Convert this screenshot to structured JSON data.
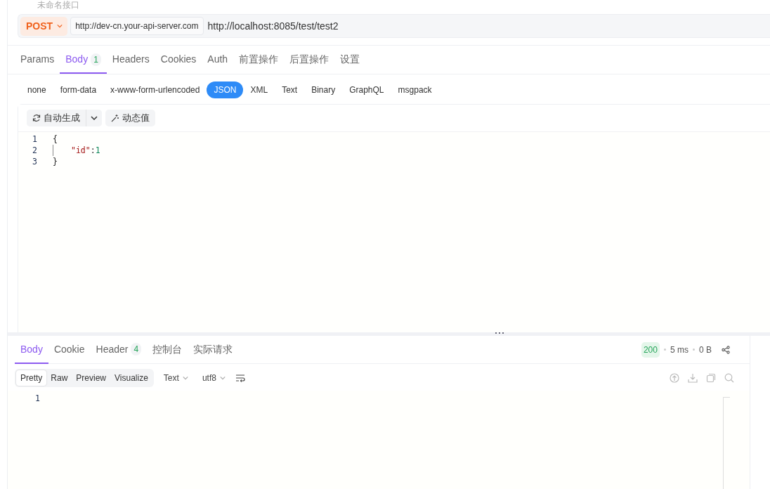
{
  "title": "未命名接口",
  "request": {
    "method": "POST",
    "base_url": "http://dev-cn.your-api-server.com",
    "path": "http://localhost:8085/test/test2"
  },
  "request_tabs": [
    {
      "label": "Params",
      "selected": false
    },
    {
      "label": "Body",
      "badge": "1",
      "selected": true
    },
    {
      "label": "Headers",
      "selected": false
    },
    {
      "label": "Cookies",
      "selected": false
    },
    {
      "label": "Auth",
      "selected": false
    },
    {
      "label": "前置操作",
      "selected": false
    },
    {
      "label": "后置操作",
      "selected": false
    },
    {
      "label": "设置",
      "selected": false
    }
  ],
  "body_types": [
    {
      "label": "none",
      "selected": false
    },
    {
      "label": "form-data",
      "selected": false
    },
    {
      "label": "x-www-form-urlencoded",
      "selected": false
    },
    {
      "label": "JSON",
      "selected": true
    },
    {
      "label": "XML",
      "selected": false
    },
    {
      "label": "Text",
      "selected": false
    },
    {
      "label": "Binary",
      "selected": false
    },
    {
      "label": "GraphQL",
      "selected": false
    },
    {
      "label": "msgpack",
      "selected": false
    }
  ],
  "editor_toolbar": {
    "generate_button": "自动生成",
    "dynamic_button": "动态值"
  },
  "editor_lines": [
    {
      "number": "1",
      "indent_guide": false,
      "tokens": [
        {
          "kind": "punct",
          "text": "{"
        }
      ]
    },
    {
      "number": "2",
      "indent_guide": true,
      "tokens": [
        {
          "kind": "key",
          "text": "\"id\""
        },
        {
          "kind": "punct",
          "text": ":"
        },
        {
          "kind": "number",
          "text": "1"
        }
      ]
    },
    {
      "number": "3",
      "indent_guide": false,
      "tokens": [
        {
          "kind": "punct",
          "text": "}"
        }
      ]
    }
  ],
  "response_tabs": [
    {
      "label": "Body",
      "selected": true
    },
    {
      "label": "Cookie",
      "selected": false
    },
    {
      "label": "Header",
      "badge": "4",
      "selected": false
    },
    {
      "label": "控制台",
      "selected": false
    },
    {
      "label": "实际请求",
      "selected": false
    }
  ],
  "response_status": {
    "code": "200",
    "time": "5 ms",
    "size": "0 B"
  },
  "view_modes": [
    {
      "label": "Pretty",
      "selected": true
    },
    {
      "label": "Raw",
      "selected": false
    },
    {
      "label": "Preview",
      "selected": false
    },
    {
      "label": "Visualize",
      "selected": false
    }
  ],
  "format_select": "Text",
  "encoding_select": "utf8",
  "response_lines": [
    "1"
  ]
}
